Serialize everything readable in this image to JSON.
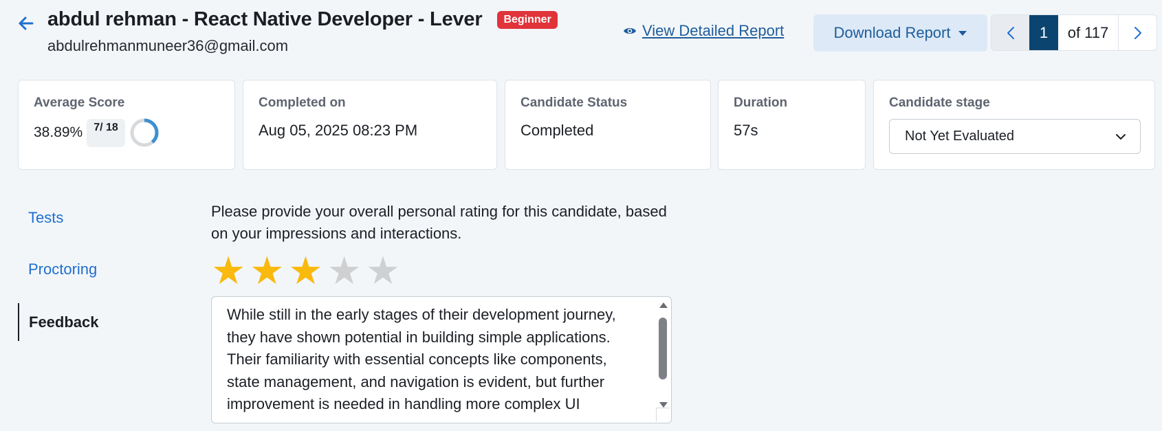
{
  "header": {
    "title": "abdul rehman - React Native Developer - Lever",
    "level_badge": "Beginner",
    "email": "abdulrehmanmuneer36@gmail.com",
    "view_report_label": "View Detailed Report",
    "download_label": "Download Report",
    "pager": {
      "current": "1",
      "of_label": "of 117"
    }
  },
  "cards": {
    "average_score": {
      "label": "Average Score",
      "percent": "38.89%",
      "correct": "7/",
      "total": "18",
      "progress": 0.3889
    },
    "completed_on": {
      "label": "Completed on",
      "value": "Aug 05, 2025 08:23 PM"
    },
    "status": {
      "label": "Candidate Status",
      "value": "Completed"
    },
    "duration": {
      "label": "Duration",
      "value": "57s"
    },
    "stage": {
      "label": "Candidate stage",
      "selected": "Not Yet Evaluated"
    }
  },
  "sidebar": {
    "items": [
      {
        "label": "Tests"
      },
      {
        "label": "Proctoring"
      },
      {
        "label": "Feedback"
      }
    ]
  },
  "feedback": {
    "prompt": "Please provide your overall personal rating for this candidate, based on your impressions and interactions.",
    "rating": 3,
    "max_rating": 5,
    "text": "While still in the early stages of their development journey, they have shown potential in building simple applications. Their familiarity with essential concepts like components, state management, and navigation is evident, but further improvement is needed in handling more complex UI"
  },
  "colors": {
    "accent": "#1e6fd0",
    "link": "#1d5d9a",
    "badge_red": "#e0333a",
    "star_on": "#f9b90d",
    "star_off": "#cfd0d2",
    "pager_active": "#0c4470",
    "donut": "#3d8fd1"
  }
}
